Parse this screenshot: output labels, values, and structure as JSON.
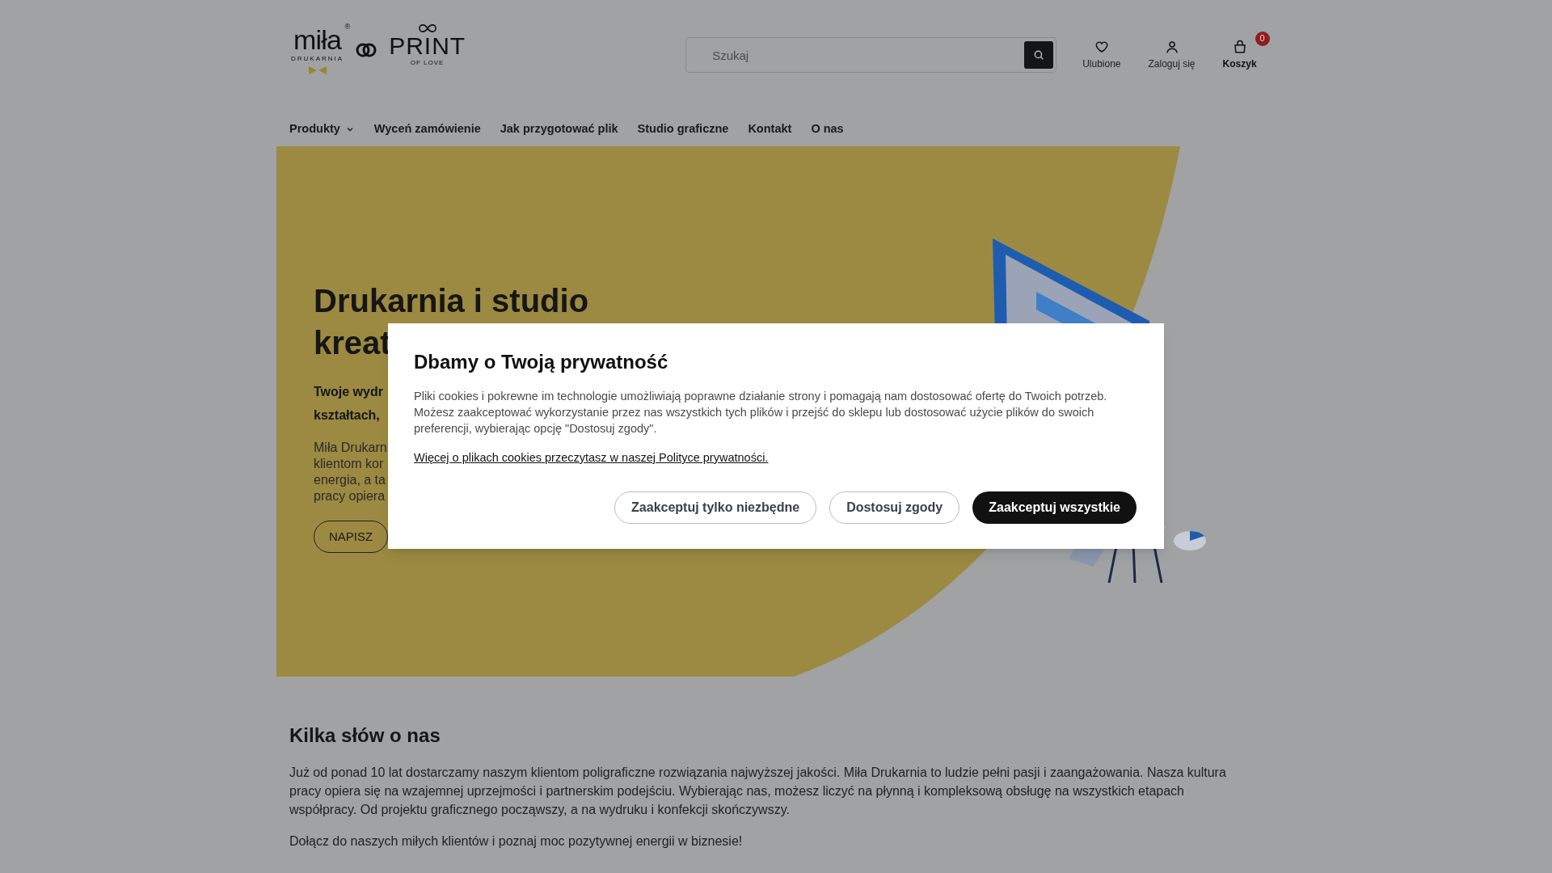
{
  "header": {
    "logo": {
      "brand": "miła",
      "registered_mark": "®",
      "brand_sub": "DRUKARNIA",
      "brand2": "PRINT",
      "brand2_sub": "OF LOVE"
    },
    "search": {
      "placeholder": "Szukaj"
    },
    "actions": [
      {
        "kind": "favorites",
        "label": "Ulubione",
        "emphasized": false
      },
      {
        "kind": "account",
        "label": "Zaloguj się",
        "emphasized": false
      },
      {
        "kind": "cart",
        "label": "Koszyk",
        "emphasized": true,
        "badge": "0"
      }
    ]
  },
  "nav": [
    {
      "label": "Produkty",
      "has_dropdown": true
    },
    {
      "label": "Wyceń zamówienie",
      "has_dropdown": false
    },
    {
      "label": "Jak przygotować plik",
      "has_dropdown": false
    },
    {
      "label": "Studio graficzne",
      "has_dropdown": false
    },
    {
      "label": "Kontakt",
      "has_dropdown": false
    },
    {
      "label": "O nas",
      "has_dropdown": false
    }
  ],
  "hero": {
    "heading_lines": [
      "Drukarnia i studio",
      "kreat"
    ],
    "subtitle_lines": [
      "Twoje wydr",
      "kształtach,"
    ],
    "paragraph_lines": [
      "Miła Drukarn",
      "klientom kor",
      "energia, a ta",
      "pracy opiera"
    ],
    "button": "NAPISZ"
  },
  "about": {
    "title": "Kilka słów o nas",
    "paragraphs": [
      "Już od ponad 10 lat dostarczamy naszym klientom poligraficzne rozwiązania najwyższej jakości. Miła Drukarnia to ludzie pełni pasji i zaangażowania. Nasza kultura pracy opiera się na wzajemnej uprzejmości i partnerskim podejściu. Wybierając nas, możesz liczyć na płynną i kompleksową obsługę na wszystkich etapach współpracy. Od projektu graficznego począwszy, a na wydruku i konfekcji skończywszy.",
      "Dołącz do naszych miłych klientów i poznaj moc pozytywnej energii w biznesie!"
    ]
  },
  "cookie_dialog": {
    "title": "Dbamy o Twoją prywatność",
    "text": "Pliki cookies i pokrewne im technologie umożliwiają poprawne działanie strony i pomagają nam dostosować ofertę do Twoich potrzeb. Możesz zaakceptować wykorzystanie przez nas wszystkich tych plików i przejść do sklepu lub dostosować użycie plików do swoich preferencji, wybierając opcję \"Dostosuj zgody\".",
    "link": "Więcej o plikach cookies przeczytasz w naszej Polityce prywatności.",
    "buttons": [
      {
        "label": "Zaakceptuj tylko niezbędne",
        "kind": "outline"
      },
      {
        "label": "Dostosuj zgody",
        "kind": "outline"
      },
      {
        "label": "Zaakceptuj wszystkie",
        "kind": "primary"
      }
    ]
  }
}
